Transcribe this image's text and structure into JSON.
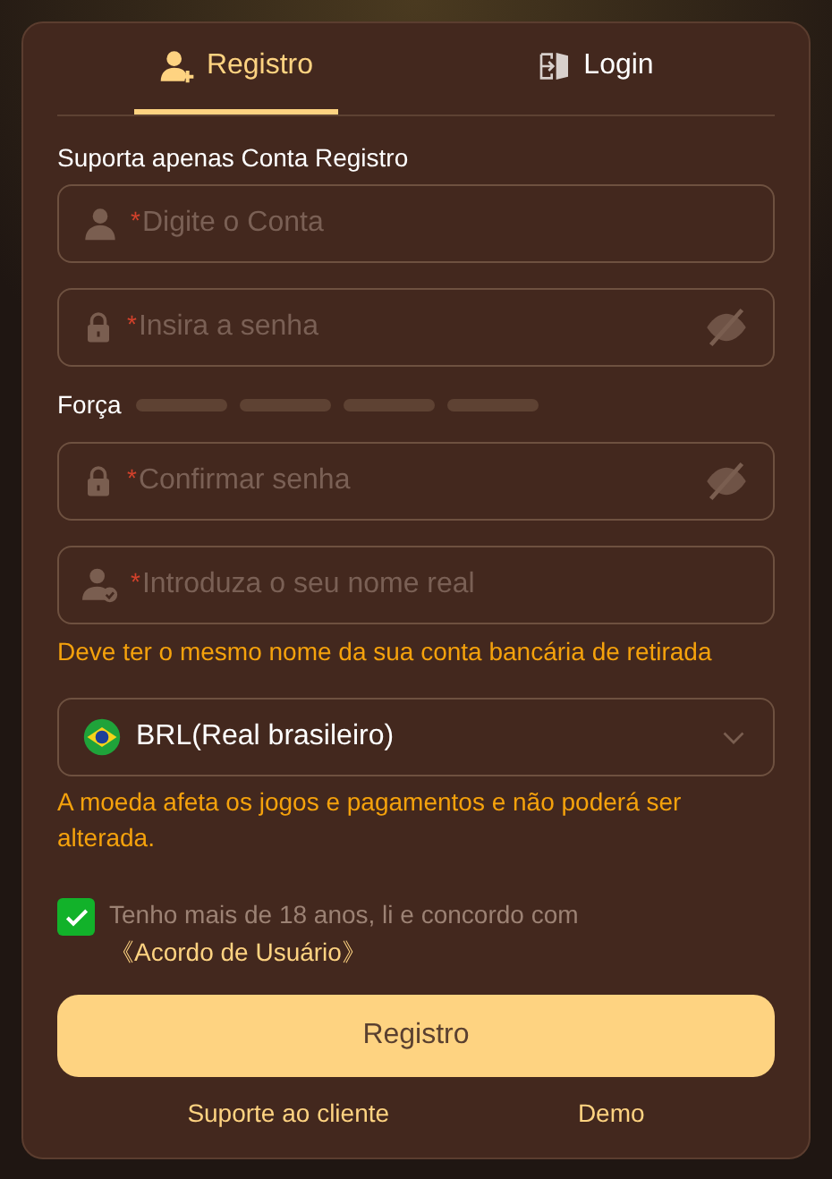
{
  "tabs": [
    {
      "label": "Registro",
      "selected": true
    },
    {
      "label": "Login",
      "selected": false
    }
  ],
  "notice": "Suporta apenas Conta Registro",
  "fields_top": [
    {
      "kind": "account",
      "marker": "*",
      "placeholder": "Digite o Conta"
    },
    {
      "kind": "password",
      "marker": "*",
      "placeholder": "Insira a senha",
      "visible": false
    }
  ],
  "strength": {
    "label": "Força"
  },
  "fields_bottom": [
    {
      "kind": "password",
      "marker": "*",
      "placeholder": "Confirmar senha",
      "visible": false
    },
    {
      "kind": "realname",
      "marker": "*",
      "placeholder": "Introduza o seu nome real"
    }
  ],
  "name_hint": "Deve ter o mesmo nome da sua conta bancária de retirada",
  "currency": {
    "value": "BRL(Real brasileiro)",
    "expanded": false
  },
  "currency_note": "A moeda afeta os jogos e pagamentos e não poderá ser alterada.",
  "agreement": {
    "checked": true,
    "text": "Tenho mais de 18 anos, li e concordo com",
    "link": "《Acordo de Usuário》"
  },
  "submit": "Registro",
  "footer_links": [
    "Suporte ao cliente",
    "Demo"
  ]
}
